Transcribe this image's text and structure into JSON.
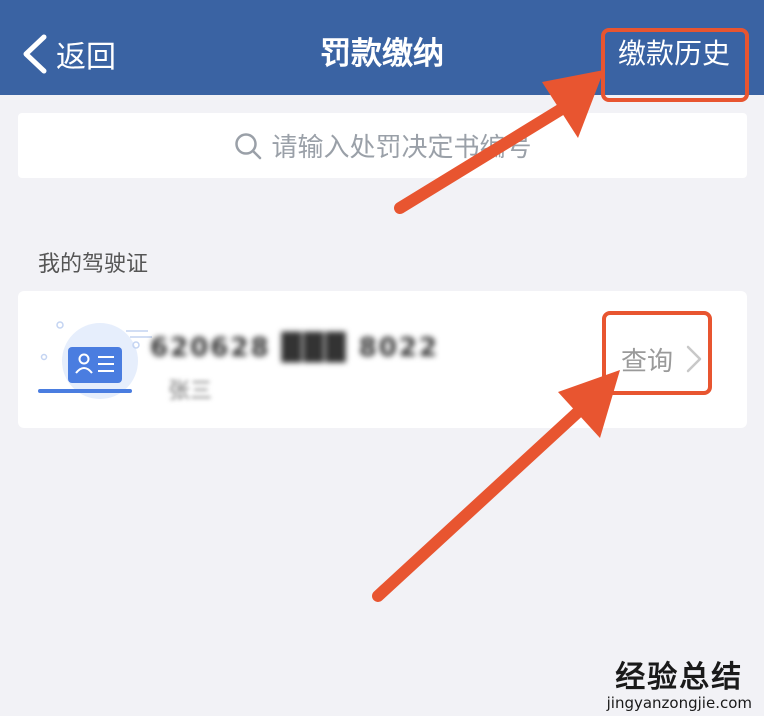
{
  "navbar": {
    "back_label": "返回",
    "title": "罚款缴纳",
    "history_label": "缴款历史"
  },
  "search": {
    "placeholder": "请输入处罚决定书编号"
  },
  "section": {
    "label": "我的驾驶证"
  },
  "license_card": {
    "number": "620628 ███ 8022",
    "name": "张三",
    "query_label": "查询"
  },
  "watermark": {
    "main": "经验总结",
    "sub": "jingyanzongjie.com"
  },
  "colors": {
    "navbar": "#3a63a3",
    "highlight": "#e85530",
    "card_icon": "#4a7de0"
  },
  "icons": [
    "back-chevron-icon",
    "search-icon",
    "id-card-icon",
    "chevron-right-icon"
  ]
}
